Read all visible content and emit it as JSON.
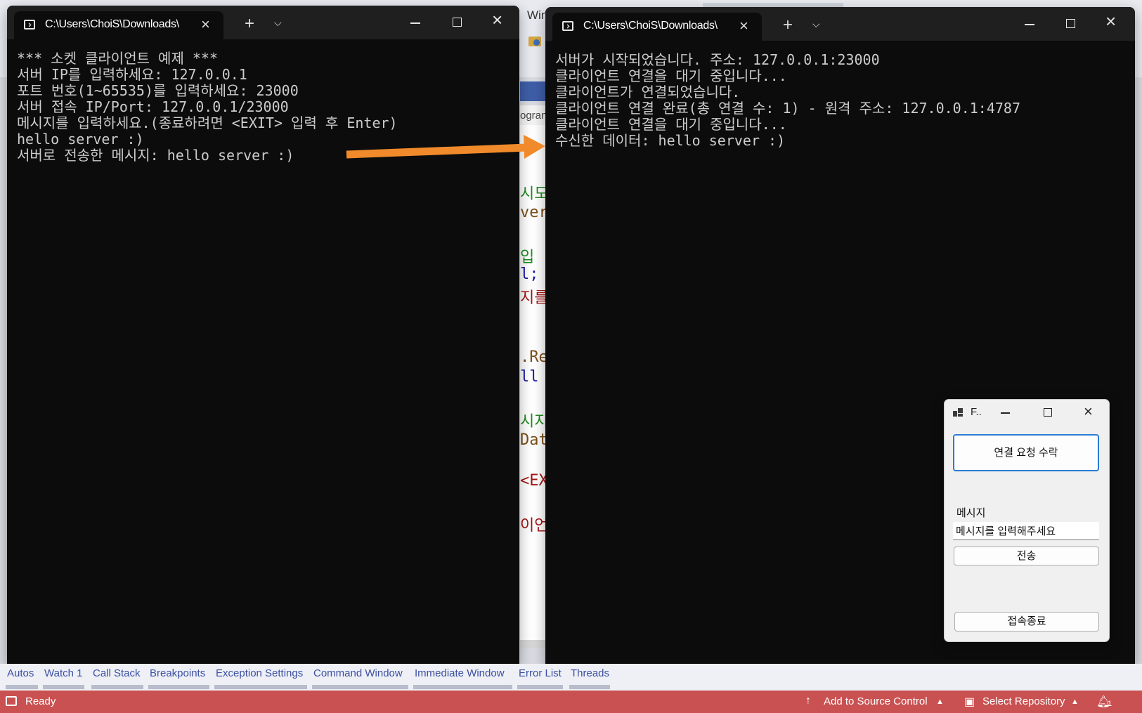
{
  "ide": {
    "window_title_fragment": "Win",
    "tab_fragment": "ogran",
    "code_fragments": [
      {
        "text": "시도",
        "color": "#1f8a1f"
      },
      {
        "text": "ver",
        "color": "#7a4f1c"
      },
      {
        "text": "입",
        "color": "#1f8a1f"
      },
      {
        "text": "l;",
        "color": "#1a1aa6"
      },
      {
        "text": "지를",
        "color": "#a31515"
      },
      {
        "text": ".Re",
        "color": "#7a4f1c"
      },
      {
        "text": "ll",
        "color": "#1a1aa6"
      },
      {
        "text": "시지",
        "color": "#1f8a1f"
      },
      {
        "text": "Dat",
        "color": "#7a4f1c"
      },
      {
        "text": "<EX",
        "color": "#a31515"
      },
      {
        "text": "이언",
        "color": "#a31515"
      }
    ],
    "bottom_tabs": [
      "Autos",
      "Watch 1",
      "Call Stack",
      "Breakpoints",
      "Exception Settings",
      "Command Window",
      "Immediate Window",
      "Error List",
      "Threads"
    ],
    "status": {
      "ready": "Ready",
      "source_control": "Add to Source Control",
      "repository": "Select Repository",
      "notifications": "1"
    }
  },
  "client_terminal": {
    "tab_title": "C:\\Users\\ChoiS\\Downloads\\",
    "lines": [
      "*** 소켓 클라이언트 예제 ***",
      "서버 IP를 입력하세요: 127.0.0.1",
      "포트 번호(1~65535)를 입력하세요: 23000",
      "서버 접속 IP/Port: 127.0.0.1/23000",
      "메시지를 입력하세요.(종료하려면 <EXIT> 입력 후 Enter)",
      "hello server :)",
      "서버로 전송한 메시지: hello server :)"
    ]
  },
  "server_terminal": {
    "tab_title": "C:\\Users\\ChoiS\\Downloads\\",
    "lines": [
      "서버가 시작되었습니다. 주소: 127.0.0.1:23000",
      "클라이언트 연결을 대기 중입니다...",
      "클라이언트가 연결되었습니다.",
      "클라이언트 연결 완료(총 연결 수: 1) - 원격 주소: 127.0.0.1:4787",
      "클라이언트 연결을 대기 중입니다...",
      "수신한 데이터: hello server :)"
    ]
  },
  "colors": {
    "arrow": "#f08a2a",
    "statusbar": "#ca5151",
    "terminal_bg": "#0c0c0c",
    "terminal_text": "#cccccc"
  },
  "form": {
    "title": "F..",
    "accept_button": "연결 요청 수락",
    "message_label": "메시지",
    "message_placeholder": "메시지를 입력해주세요",
    "send_button": "전송",
    "disconnect_button": "접속종료"
  }
}
